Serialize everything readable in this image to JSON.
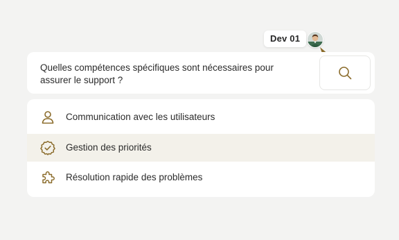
{
  "cursor": {
    "label": "Dev 01",
    "avatar_icon": "user-avatar-photo",
    "pointer_color": "#8a6b2a"
  },
  "search": {
    "question": "Quelles compétences spécifiques sont nécessaires pour assurer le support ?",
    "button_icon": "search-icon"
  },
  "suggestions": {
    "items": [
      {
        "label": "Communication avec les utilisateurs",
        "icon": "user-icon",
        "selected": false
      },
      {
        "label": "Gestion des priorités",
        "icon": "check-badge-icon",
        "selected": true
      },
      {
        "label": "Résolution rapide des problèmes",
        "icon": "puzzle-icon",
        "selected": false
      }
    ]
  },
  "colors": {
    "accent": "#8a6b2a",
    "selected_row": "#f3f1ea",
    "background": "#f3f3f2"
  }
}
